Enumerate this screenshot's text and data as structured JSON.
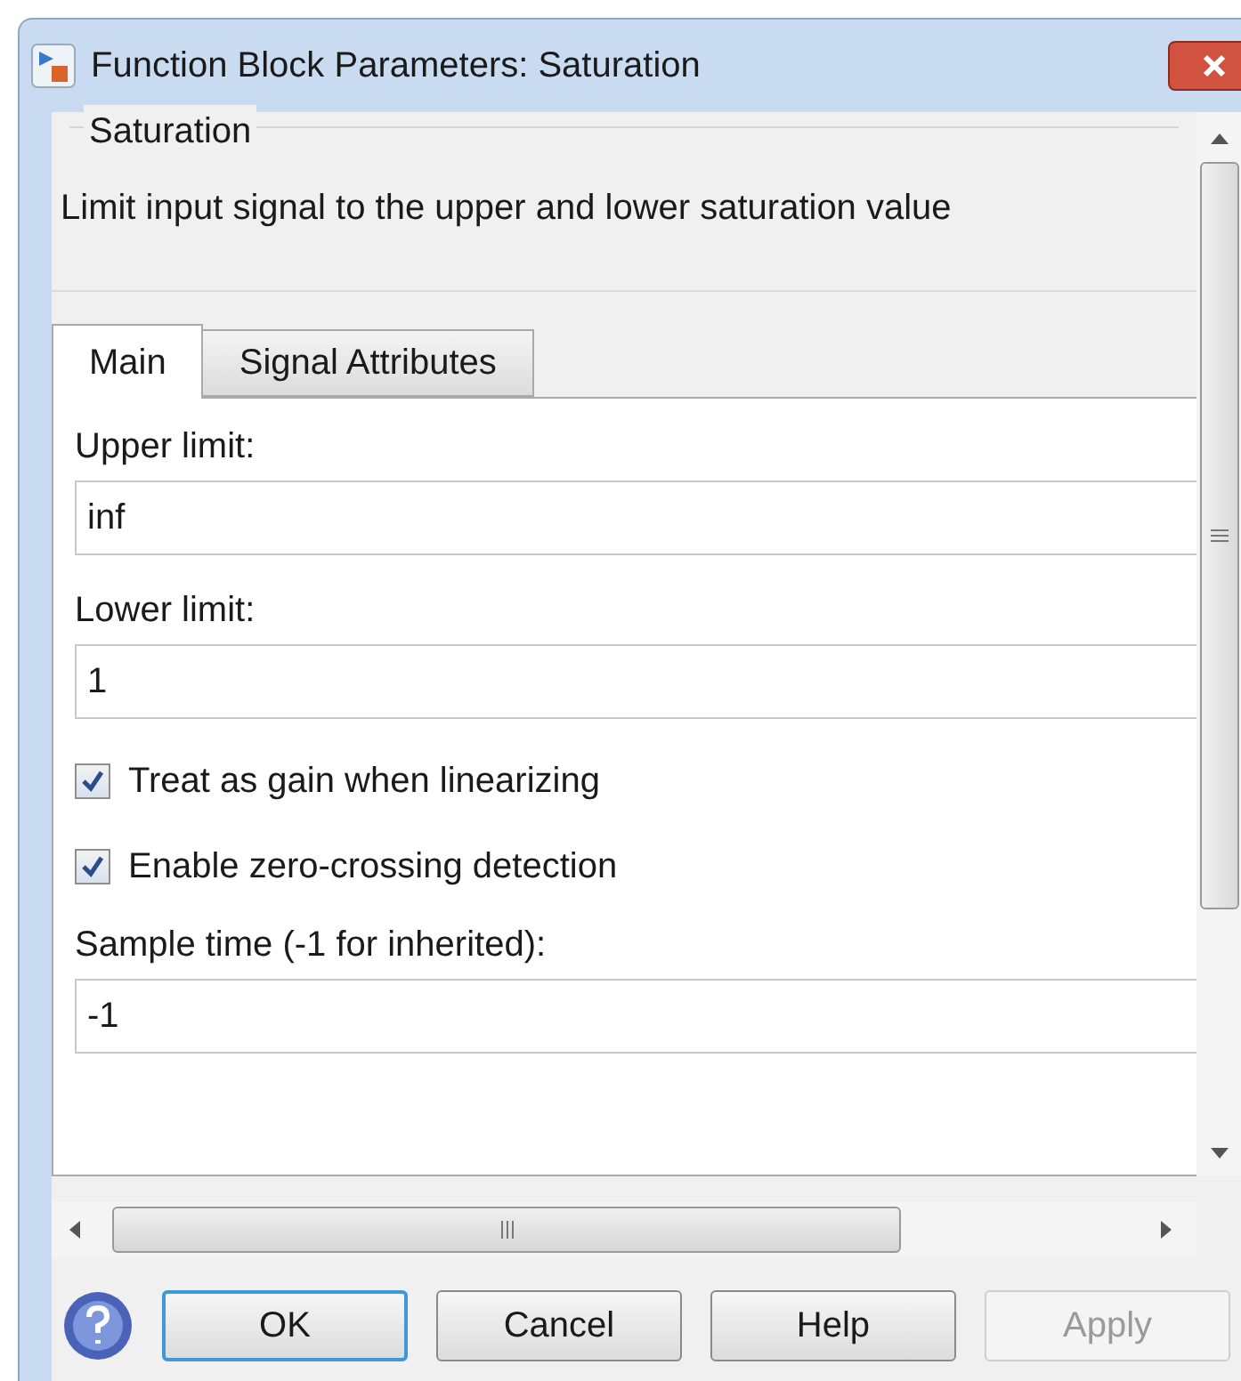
{
  "window": {
    "title": "Function Block Parameters: Saturation"
  },
  "block": {
    "name": "Saturation",
    "description": "Limit input signal to the upper and lower saturation value"
  },
  "tabs": [
    {
      "label": "Main",
      "selected": true
    },
    {
      "label": "Signal Attributes",
      "selected": false
    }
  ],
  "parameters": [
    {
      "kind": "field",
      "label": "Upper limit:",
      "value": "inf"
    },
    {
      "kind": "field",
      "label": "Lower limit:",
      "value": "1"
    },
    {
      "kind": "checkbox",
      "label": "Treat as gain when linearizing",
      "checked": true
    },
    {
      "kind": "checkbox",
      "label": "Enable zero-crossing detection",
      "checked": true
    },
    {
      "kind": "field",
      "label": "Sample time (-1 for inherited):",
      "value": "-1"
    }
  ],
  "buttons": [
    {
      "label": "OK",
      "focused": true,
      "disabled": false
    },
    {
      "label": "Cancel",
      "focused": false,
      "disabled": false
    },
    {
      "label": "Help",
      "focused": false,
      "disabled": false
    },
    {
      "label": "Apply",
      "focused": false,
      "disabled": true
    }
  ]
}
